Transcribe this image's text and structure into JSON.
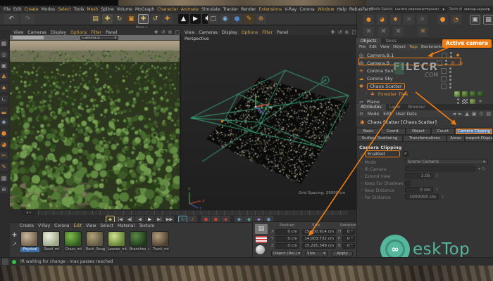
{
  "menu_bar": {
    "items": [
      "File",
      "Edit",
      "Create",
      "Modes",
      "Select",
      "Tools",
      "Mesh",
      "Spline",
      "Volume",
      "MoGraph",
      "Character",
      "Animate",
      "Simulate",
      "Tracker",
      "Render",
      "Extensions",
      "V-Ray",
      "Corona",
      "Window",
      "Help",
      "RebusFarm"
    ]
  },
  "top_bar": {
    "node_space_label": "Node Space:",
    "node_space_value": "Current (Standard/Physical)",
    "save_label": "Save at",
    "save_value": "Startup Layout"
  },
  "toolbar": {
    "mode_label": "Mode",
    "icons": [
      {
        "name": "undo",
        "glyph": "↶"
      },
      {
        "name": "redo",
        "glyph": "↷"
      },
      {
        "name": "grid-snap",
        "glyph": "▤"
      },
      {
        "name": "move-tool",
        "glyph": "✚"
      },
      {
        "name": "rotate-tool",
        "glyph": "↻"
      },
      {
        "name": "scale-tool",
        "glyph": "▣"
      },
      {
        "name": "move-selected",
        "glyph": "✚"
      },
      {
        "name": "rotate-alt",
        "glyph": "↺"
      },
      {
        "name": "add-tool",
        "glyph": "✚"
      },
      {
        "name": "render-view",
        "glyph": "▲"
      },
      {
        "name": "render-active",
        "glyph": "▶"
      },
      {
        "name": "render-settings",
        "glyph": "✱"
      },
      {
        "name": "axis-x",
        "glyph": "X"
      },
      {
        "name": "axis-y",
        "glyph": "Y"
      },
      {
        "name": "axis-z",
        "glyph": "Z"
      },
      {
        "name": "coord-system",
        "glyph": "⊕"
      },
      {
        "name": "layout-monitor",
        "glyph": "▢"
      },
      {
        "name": "sphere-light",
        "glyph": "◉"
      },
      {
        "name": "sphere-dark",
        "glyph": "●"
      },
      {
        "name": "pen",
        "glyph": "✎"
      }
    ]
  },
  "left_toolbar": {
    "icons": [
      {
        "name": "cube-icon",
        "glyph": "▦"
      },
      {
        "name": "sphere-icon",
        "glyph": "◎"
      },
      {
        "name": "camera-icon",
        "glyph": "▣"
      },
      {
        "name": "tree-icon",
        "glyph": "♣"
      },
      {
        "name": "plant-icon",
        "glyph": "♠"
      },
      {
        "name": "corner-icon",
        "glyph": "∟"
      },
      {
        "name": "bar-icon",
        "glyph": "▂"
      },
      {
        "name": "rock-icon",
        "glyph": "◆"
      },
      {
        "name": "corona-ball-icon",
        "glyph": "●"
      },
      {
        "name": "corona-ir-icon",
        "glyph": "◕"
      },
      {
        "name": "scissors-icon",
        "glyph": "✂"
      },
      {
        "name": "pencil-icon",
        "glyph": "✎"
      },
      {
        "name": "checker-icon",
        "glyph": "▩"
      },
      {
        "name": "target-icon",
        "glyph": "⊕"
      }
    ]
  },
  "viewport_left": {
    "menu": [
      "View",
      "Cameras",
      "Display",
      "Options",
      "Filter",
      "Panel"
    ],
    "camera_dropdown": "Camera.B"
  },
  "viewport_right": {
    "menu": [
      "View",
      "Cameras",
      "Display",
      "Options",
      "Filter",
      "Panel"
    ],
    "label": "Perspective",
    "grid_spacing": "Grid Spacing: 20000 cm"
  },
  "plugin_rows": {
    "row1": [
      {
        "name": "corona-sphere",
        "glyph": "●"
      },
      {
        "name": "corona-arrow",
        "glyph": "◕"
      },
      {
        "name": "anima-figure",
        "glyph": "✱"
      },
      {
        "name": "dim-a",
        "glyph": "✕"
      },
      {
        "name": "dim-b",
        "glyph": "✕"
      },
      {
        "name": "corona-render",
        "glyph": "●"
      },
      {
        "name": "corona-ir",
        "glyph": "◔"
      },
      {
        "name": "vfb-frame",
        "glyph": "▣"
      },
      {
        "name": "vfb-frame2",
        "glyph": "▦"
      },
      {
        "name": "scatter-box",
        "glyph": "■"
      }
    ],
    "row2": [
      {
        "name": "scatter-tool-1",
        "glyph": "✖"
      },
      {
        "name": "scatter-tool-2",
        "glyph": "✖"
      },
      {
        "name": "scatter-tool-3",
        "glyph": "✖"
      },
      {
        "name": "scatter-tool-4",
        "glyph": "✖"
      }
    ]
  },
  "objects_panel": {
    "tabs": [
      "Objects",
      "Takes"
    ],
    "menu": [
      "File",
      "Edit",
      "View",
      "Object",
      "Tags",
      "Bookmarks"
    ],
    "badge_label": "Active camera",
    "items": [
      {
        "name": "Camera.B.1"
      },
      {
        "name": "Camera.B"
      },
      {
        "name": "Corona Sun"
      },
      {
        "name": "Corona Sky"
      },
      {
        "name": "Chaos Scatter"
      },
      {
        "name": "Forester Tree"
      },
      {
        "name": "Plane"
      }
    ]
  },
  "attributes_panel": {
    "tabs": [
      "Attributes",
      "Layer",
      "Browser"
    ],
    "menu": [
      "Mode",
      "Edit",
      "User Data"
    ],
    "object_title": "Chaos Scatter [Chaos Scatter]",
    "tab_buttons_row1": [
      "Basic",
      "Coord.",
      "Object",
      "Count",
      "Camera Clipping"
    ],
    "tab_buttons_row2": [
      "Surface Scattering",
      "Transformations",
      "Areas",
      "Viewport Display"
    ],
    "section_title": "Camera Clipping",
    "params": {
      "enabled_label": "Enabled",
      "mode_label": "Mode",
      "mode_value": "Scene Camera",
      "ir_camera_label": "IR Camera",
      "extend_view_label": "Extend View",
      "extend_view_value": "1.05",
      "shadows_label": "Keep For Shadows",
      "near_label": "Near Distance",
      "near_value": "0 cm",
      "far_label": "Far Distance",
      "far_value": "1000000 cm"
    }
  },
  "materials_panel": {
    "menu": [
      "Create",
      "V-Ray",
      "Corona",
      "Edit",
      "View",
      "Select",
      "Material",
      "Texture"
    ],
    "materials": [
      {
        "name": "Physical",
        "c1": "#c9b89e",
        "c2": "#6f604c",
        "selected": true
      },
      {
        "name": "Seed_mt",
        "c1": "#eff1e3",
        "c2": "#99a487",
        "selected": false
      },
      {
        "name": "Grass_mt",
        "c1": "#83bb4e",
        "c2": "#2f5c1e",
        "selected": false
      },
      {
        "name": "Rock_Roug",
        "c1": "#b0a177",
        "c2": "#5c5742",
        "selected": false
      },
      {
        "name": "Leaves_mt",
        "c1": "#d2e18e",
        "c2": "#5f7f33",
        "selected": false
      },
      {
        "name": "Branches_m",
        "c1": "#5a8a45",
        "c2": "#20391a",
        "selected": false
      },
      {
        "name": "Trunk_mt",
        "c1": "#b49c7a",
        "c2": "#4e4132",
        "selected": false
      }
    ]
  },
  "coordinates_panel": {
    "headers": [
      "Position",
      "Size",
      "Rotation"
    ],
    "rows": [
      {
        "axis": "X",
        "pos": "0 cm",
        "size": "15,000.914 cm",
        "rot_axis": "H",
        "rot": "0 °"
      },
      {
        "axis": "Y",
        "pos": "0 cm",
        "size": "14,003.732 cm",
        "rot_axis": "P",
        "rot": "0 °"
      },
      {
        "axis": "Z",
        "pos": "0 cm",
        "size": "15,291.349 cm",
        "rot_axis": "B",
        "rot": "0 °"
      }
    ],
    "mode_dropdown": "Object (Rel.)",
    "size_dropdown": "Size",
    "apply_label": "Apply"
  },
  "timeline": {
    "frame_label": "0 F",
    "transport_glyphs": [
      "◆",
      "|◀",
      "◀|",
      "◀",
      "▶",
      "▶|",
      "▶▶",
      "↻",
      "♪",
      "●",
      "●",
      "◉",
      "◆",
      "◆",
      "◆",
      "▣"
    ]
  },
  "status_bar": {
    "message": "IR waiting for change - max passes reached"
  },
  "watermark": {
    "line1": "FILECR",
    "line2": ".COM"
  },
  "logo": {
    "text": "eskTop"
  },
  "colors": {
    "accent_orange": "#f07d12",
    "corona_orange": "#e8872a",
    "selection_blue": "#4d79b0",
    "wire_green": "#38b381",
    "logo_teal": "#55b79b"
  }
}
